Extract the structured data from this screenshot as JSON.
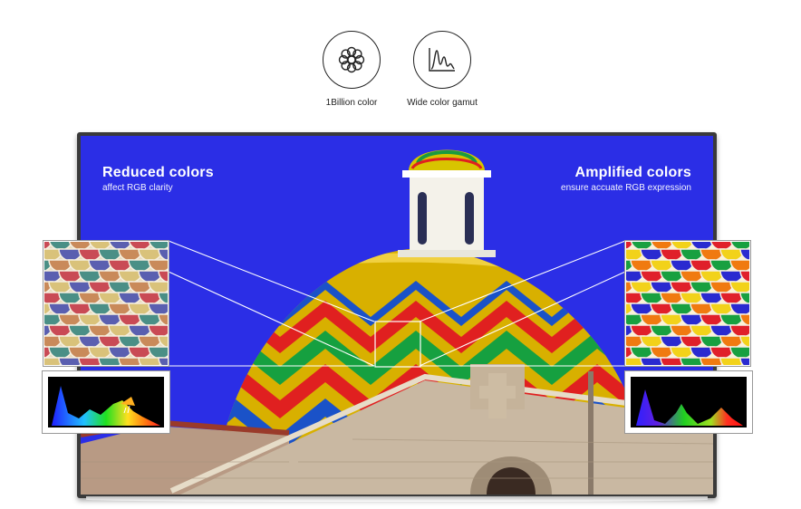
{
  "features": [
    {
      "label": "1Billion color",
      "icon": "flower-icon"
    },
    {
      "label": "Wide color gamut",
      "icon": "spectrum-graph-icon"
    }
  ],
  "captions": {
    "left": {
      "title": "Reduced colors",
      "subtitle": "affect RGB clarity"
    },
    "right": {
      "title": "Amplified colors",
      "subtitle": "ensure accuate RGB expression"
    }
  },
  "colors": {
    "sky": "#2b2ee6",
    "reduced_tiles": [
      "#c94a55",
      "#d9c27a",
      "#4a8f86",
      "#5a5fb0",
      "#c98a5a"
    ],
    "amplified_tiles": [
      "#e0202a",
      "#f2d21a",
      "#18a040",
      "#2a2ad0",
      "#f07a10"
    ]
  }
}
